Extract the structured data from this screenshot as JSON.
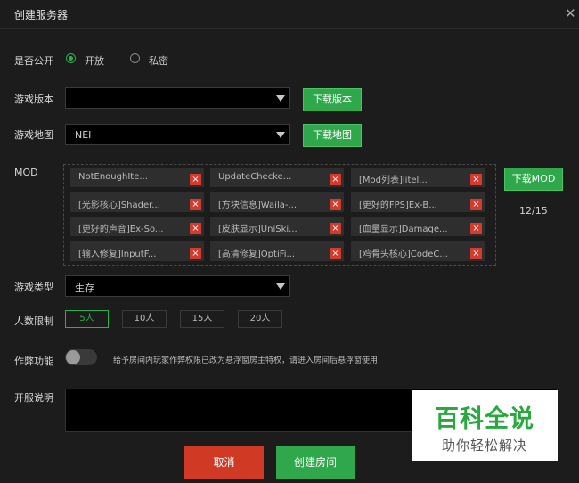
{
  "dialog": {
    "title": "创建服务器",
    "close_glyph": "✕"
  },
  "visibility": {
    "label": "是否公开",
    "options": [
      "开放",
      "私密"
    ],
    "selected": "开放"
  },
  "version": {
    "label": "游戏版本",
    "value": "",
    "download_label": "下载版本"
  },
  "map": {
    "label": "游戏地图",
    "value": "NEI",
    "download_label": "下载地图"
  },
  "mod": {
    "label": "MOD",
    "items": [
      "NotEnoughIte...",
      "UpdateChecke...",
      "[Mod列表]litel...",
      "[光影核心]Shader...",
      "[方块信息]Waila-...",
      "[更好的FPS]Ex-B...",
      "[更好的声音]Ex-So...",
      "[皮肤显示]UniSki...",
      "[血量显示]Damage...",
      "[输入修复]InputF...",
      "[高清修复]OptiFi...",
      "[鸡骨头核心]CodeC..."
    ],
    "remove_glyph": "×",
    "download_label": "下载MOD",
    "count": "12/15"
  },
  "game_type": {
    "label": "游戏类型",
    "value": "生存"
  },
  "players": {
    "label": "人数限制",
    "options": [
      "5人",
      "10人",
      "15人",
      "20人"
    ],
    "selected": "5人"
  },
  "cheat": {
    "label": "作弊功能",
    "enabled": false,
    "hint": "给予房间内玩家作弊权限已改为悬浮窗房主特权，请进入房间后悬浮窗使用"
  },
  "description": {
    "label": "开服说明",
    "value": ""
  },
  "actions": {
    "cancel": "取消",
    "create": "创建房间"
  },
  "watermark": {
    "line1": "百科全说",
    "line2": "助你轻松解决"
  },
  "colors": {
    "accent": "#2ea84a",
    "danger": "#d03a25",
    "background": "#1c1c1c"
  }
}
